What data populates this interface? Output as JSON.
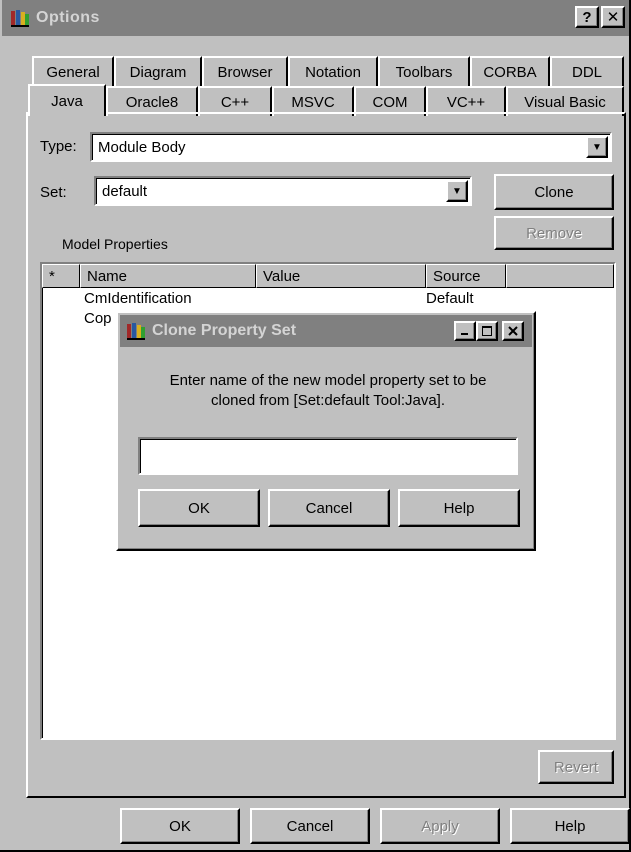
{
  "window": {
    "title": "Options",
    "help_label": "?",
    "close_label": "✕"
  },
  "tabs": {
    "row1": [
      "General",
      "Diagram",
      "Browser",
      "Notation",
      "Toolbars",
      "CORBA",
      "DDL"
    ],
    "row2": [
      "Java",
      "Oracle8",
      "C++",
      "MSVC",
      "COM",
      "VC++",
      "Visual Basic"
    ],
    "active": "Java"
  },
  "form": {
    "type_label": "Type:",
    "type_value": "Module Body",
    "set_label": "Set:",
    "set_value": "default",
    "clone_label": "Clone",
    "remove_label": "Remove",
    "model_properties_label": "Model Properties"
  },
  "property_list": {
    "columns": [
      "*",
      "Name",
      "Value",
      "Source",
      ""
    ],
    "rows": [
      {
        "name": "CmIdentification",
        "value": "",
        "source": "Default"
      },
      {
        "name": "Cop",
        "value": "",
        "source": ""
      }
    ]
  },
  "revert_label": "Revert",
  "footer": {
    "ok": "OK",
    "cancel": "Cancel",
    "apply": "Apply",
    "help": "Help"
  },
  "dialog": {
    "title": "Clone Property Set",
    "message_line1": "Enter name of the new model property set to be",
    "message_line2": "cloned from [Set:default Tool:Java].",
    "input_value": "",
    "ok": "OK",
    "cancel": "Cancel",
    "help": "Help"
  },
  "colors": {
    "face": "#c0c0c0",
    "inactive_title": "#808080",
    "inactive_title_text": "#d4d4d4"
  }
}
